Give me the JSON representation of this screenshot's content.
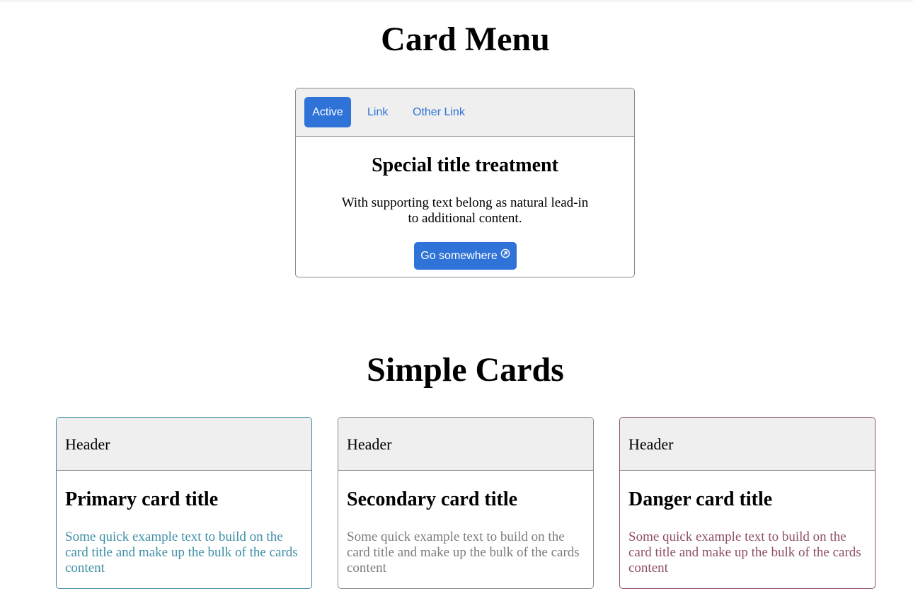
{
  "card_menu": {
    "section_title": "Card Menu",
    "tabs": [
      {
        "label": "Active",
        "active": true
      },
      {
        "label": "Link",
        "active": false
      },
      {
        "label": "Other Link",
        "active": false
      }
    ],
    "title": "Special title treatment",
    "text": "With supporting text belong as natural lead-in to additional content.",
    "button_label": "Go somewhere",
    "button_icon": "external-link-circle-icon"
  },
  "simple_cards": {
    "section_title": "Simple Cards",
    "cards": [
      {
        "variant": "primary",
        "header": "Header",
        "title": "Primary card title",
        "text": "Some quick example text to build on the card title and make up the bulk of the cards content",
        "color": "#3f8fa6"
      },
      {
        "variant": "secondary",
        "header": "Header",
        "title": "Secondary card title",
        "text": "Some quick example text to build on the card title and make up the bulk of the cards content",
        "color": "#7c7c7c"
      },
      {
        "variant": "danger",
        "header": "Header",
        "title": "Danger card title",
        "text": "Some quick example text to build on the card title and make up the bulk of the cards content",
        "color": "#8f4f63"
      }
    ]
  },
  "colors": {
    "accent": "#2f72d8",
    "header_bg": "#efefef",
    "border": "#8a8a8a"
  }
}
